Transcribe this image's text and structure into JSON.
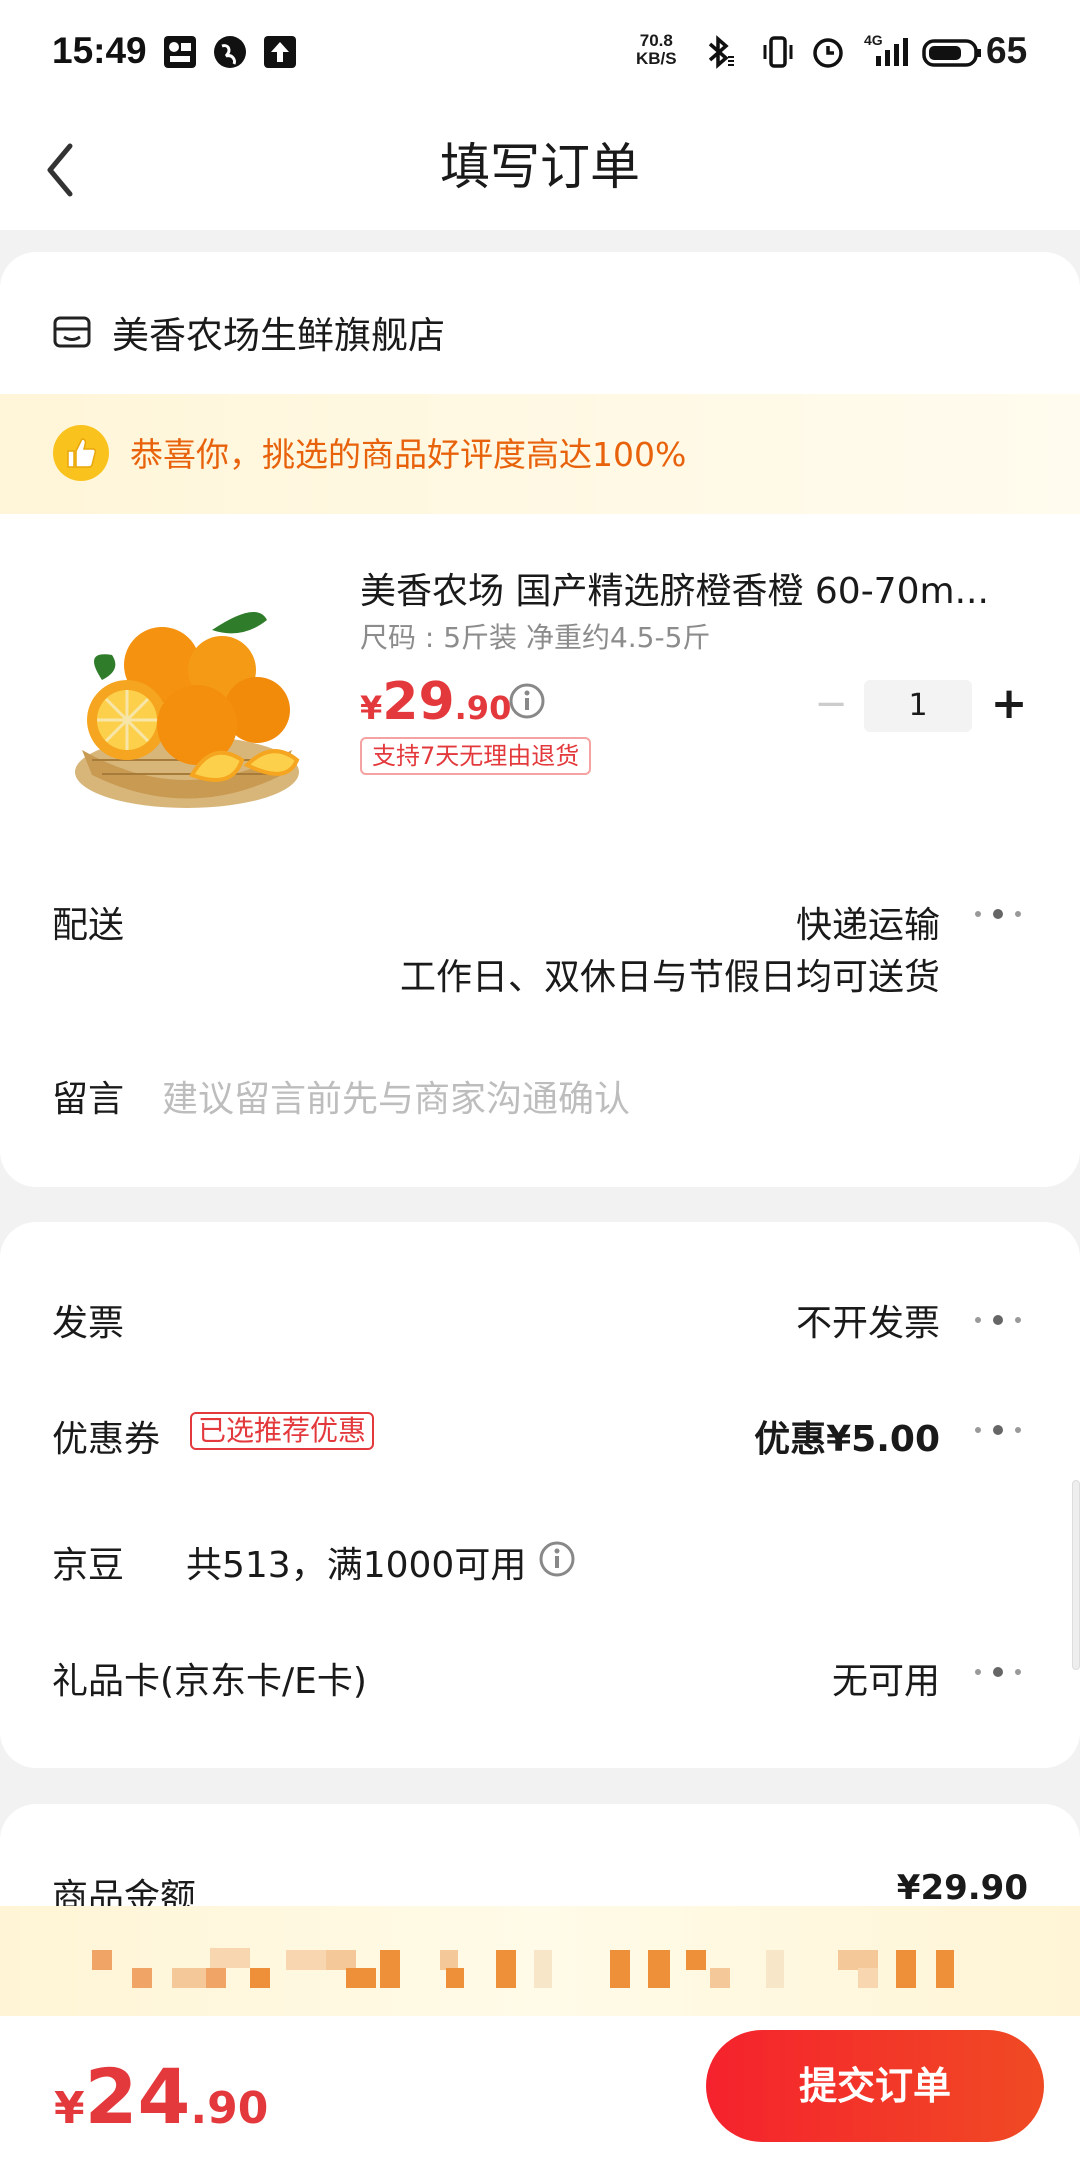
{
  "status_bar": {
    "time": "15:49",
    "net_speed_value": "70.8",
    "net_speed_unit": "KB/S",
    "network": "4G",
    "battery": "65"
  },
  "nav": {
    "title": "填写订单",
    "back_icon": "chevron-left-icon"
  },
  "store": {
    "icon": "store-icon",
    "name": "美香农场生鲜旗舰店"
  },
  "promo": {
    "icon": "thumbs-up-icon",
    "text": "恭喜你，挑选的商品好评度高达100%"
  },
  "product": {
    "title": "美香农场 国产精选脐橙香橙 60-70m...",
    "spec": "尺码 : 5斤装 净重约4.5-5斤",
    "price_symbol": "¥",
    "price_int": "29",
    "price_dec": ".90",
    "return_tag": "支持7天无理由退货",
    "qty_minus": "−",
    "quantity": "1",
    "qty_plus": "+"
  },
  "delivery": {
    "label": "配送",
    "value": "快递运输",
    "sub": "工作日、双休日与节假日均可送货"
  },
  "message": {
    "label": "留言",
    "placeholder": "建议留言前先与商家沟通确认"
  },
  "invoice": {
    "label": "发票",
    "value": "不开发票"
  },
  "coupon": {
    "label": "优惠券",
    "tag": "已选推荐优惠",
    "value": "优惠¥5.00"
  },
  "beans": {
    "label": "京豆",
    "detail": "共513，满1000可用"
  },
  "gift_card": {
    "label": "礼品卡(京东卡/E卡)",
    "value": "无可用"
  },
  "summary": {
    "label": "商品金额",
    "amount": "¥29.90"
  },
  "footer": {
    "total_symbol": "¥",
    "total_int": "24",
    "total_dec": ".90",
    "submit_label": "提交订单"
  },
  "colors": {
    "accent_red": "#e4393c",
    "promo_orange": "#e8620c",
    "promo_bg": "#fff6d9"
  }
}
